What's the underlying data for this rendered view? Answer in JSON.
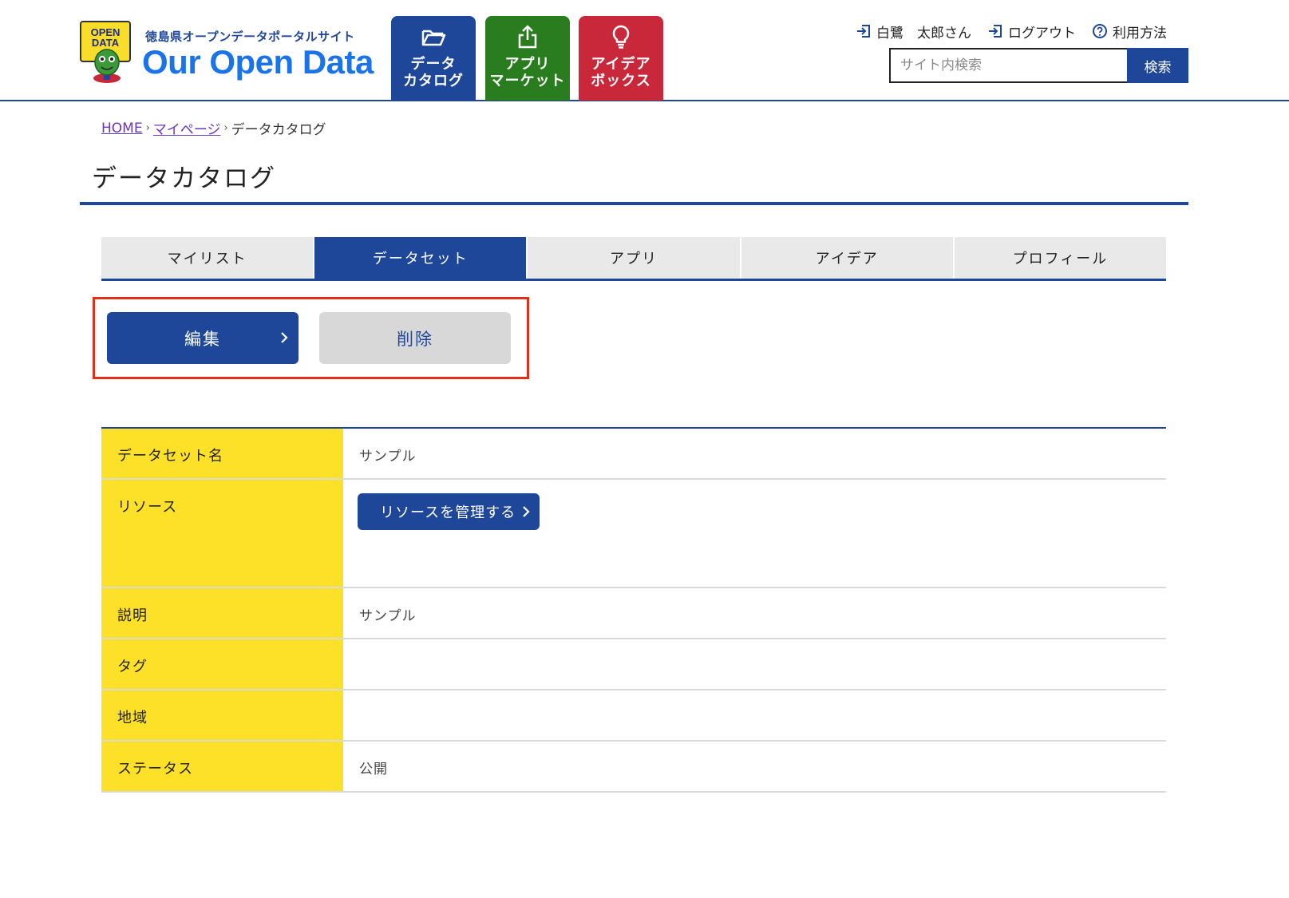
{
  "header": {
    "logo": {
      "badge_line1": "OPEN",
      "badge_line2": "DATA",
      "subtitle": "徳島県オープンデータポータルサイト",
      "title": "Our Open Data"
    },
    "nav": [
      {
        "label": "データ\nカタログ",
        "icon": "folder-open-icon",
        "color": "#1f4799"
      },
      {
        "label": "アプリ\nマーケット",
        "icon": "share-upload-icon",
        "color": "#2a7d1f"
      },
      {
        "label": "アイデア\nボックス",
        "icon": "lightbulb-icon",
        "color": "#c8283a"
      }
    ],
    "user_links": {
      "user_name": "白鷺　太郎さん",
      "logout": "ログアウト",
      "help": "利用方法"
    },
    "search": {
      "placeholder": "サイト内検索",
      "button": "検索"
    }
  },
  "breadcrumb": {
    "home": "HOME",
    "mypage": "マイページ",
    "current": "データカタログ",
    "separator": "›"
  },
  "page_title": "データカタログ",
  "tabs": [
    {
      "label": "マイリスト",
      "active": false
    },
    {
      "label": "データセット",
      "active": true
    },
    {
      "label": "アプリ",
      "active": false
    },
    {
      "label": "アイデア",
      "active": false
    },
    {
      "label": "プロフィール",
      "active": false
    }
  ],
  "actions": {
    "edit": "編集",
    "delete": "削除"
  },
  "detail": [
    {
      "key": "データセット名",
      "value": "サンプル"
    },
    {
      "key": "リソース",
      "button": "リソースを管理する"
    },
    {
      "key": "説明",
      "value": "サンプル"
    },
    {
      "key": "タグ",
      "value": ""
    },
    {
      "key": "地域",
      "value": ""
    },
    {
      "key": "ステータス",
      "value": "公開"
    }
  ],
  "colors": {
    "primary": "#1f4799",
    "apps_green": "#2a7d1f",
    "ideas_red": "#c8283a",
    "label_yellow": "#fde028",
    "highlight_red": "#e03018",
    "link_purple": "#6a35c2"
  }
}
